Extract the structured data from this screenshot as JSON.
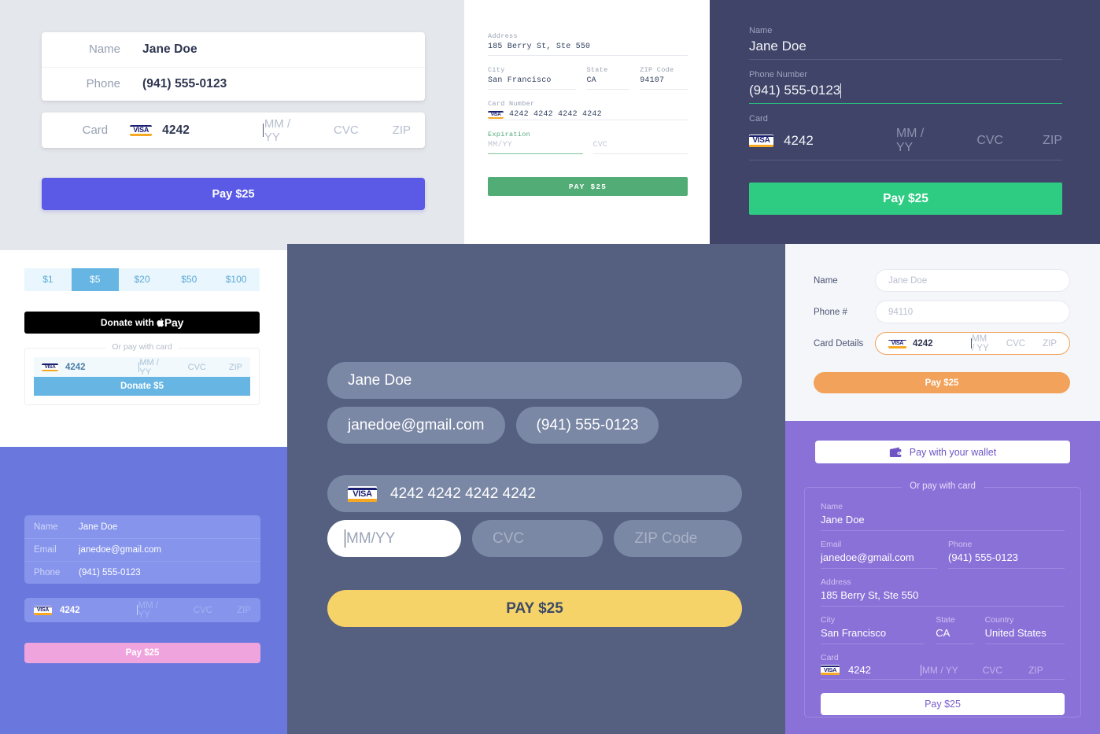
{
  "shared": {
    "visa_label": "VISA",
    "card_last4": "4242",
    "card_full": "4242 4242 4242 4242",
    "ph_mmyy_spaced": "MM / YY",
    "ph_mmyy": "MM/YY",
    "ph_cvc": "CVC",
    "ph_zip": "ZIP",
    "ph_zipcode": "ZIP Code",
    "name": "Jane Doe",
    "phone": "(941) 555-0123",
    "email": "janedoe@gmail.com",
    "address": "185 Berry St, Ste 550",
    "city": "San Francisco",
    "state": "CA",
    "zip": "94107",
    "country": "United States"
  },
  "panel1": {
    "labels": {
      "name": "Name",
      "phone": "Phone",
      "card": "Card"
    },
    "values": {
      "name": "Jane Doe",
      "phone": "(941) 555-0123",
      "card_last4": "4242"
    },
    "placeholders": {
      "mmyy": "MM / YY",
      "cvc": "CVC",
      "zip": "ZIP"
    },
    "pay_label": "Pay $25",
    "accent": "#5a5ae6"
  },
  "panel2": {
    "labels": {
      "address": "Address",
      "city": "City",
      "state": "State",
      "zip": "ZIP Code",
      "card_number": "Card Number",
      "expiration": "Expiration"
    },
    "values": {
      "address": "185 Berry St, Ste 550",
      "city": "San Francisco",
      "state": "CA",
      "zip": "94107",
      "card_full": "4242 4242 4242 4242"
    },
    "placeholders": {
      "mmyy": "MM/YY",
      "cvc": "CVC"
    },
    "pay_label": "PAY $25",
    "accent": "#51ac75"
  },
  "panel3": {
    "labels": {
      "name": "Name",
      "phone": "Phone Number",
      "card": "Card"
    },
    "values": {
      "name": "Jane Doe",
      "phone": "(941) 555-0123",
      "card_last4": "4242"
    },
    "placeholders": {
      "mmyy": "MM / YY",
      "cvc": "CVC",
      "zip": "ZIP"
    },
    "pay_label": "Pay $25",
    "accent": "#2ecc82",
    "background": "#3f4468"
  },
  "panel4": {
    "amounts": [
      "$1",
      "$5",
      "$20",
      "$50",
      "$100"
    ],
    "selected_amount": "$5",
    "apple_pay_label": "Donate with",
    "apple_pay_mark": "Pay",
    "or_pay_label": "Or pay with card",
    "card_last4": "4242",
    "placeholders": {
      "mmyy": "MM / YY",
      "cvc": "CVC",
      "zip": "ZIP"
    },
    "donate_label": "Donate $5",
    "accent": "#66b5e3"
  },
  "panel5": {
    "labels": {
      "name": "Name",
      "email": "Email",
      "phone": "Phone"
    },
    "values": {
      "name": "Jane Doe",
      "email": "janedoe@gmail.com",
      "phone": "(941) 555-0123",
      "card_last4": "4242"
    },
    "placeholders": {
      "mmyy": "MM / YY",
      "cvc": "CVC",
      "zip": "ZIP"
    },
    "pay_label": "Pay $25",
    "accent": "#efa4de",
    "background": "#6a78dd"
  },
  "panel6": {
    "values": {
      "name": "Jane Doe",
      "email": "janedoe@gmail.com",
      "phone": "(941) 555-0123",
      "card_full": "4242 4242 4242 4242"
    },
    "placeholders": {
      "mmyy": "MM/YY",
      "cvc": "CVC",
      "zip": "ZIP Code"
    },
    "pay_label": "PAY $25",
    "accent": "#f5d368",
    "background": "#556080"
  },
  "panel7": {
    "labels": {
      "name": "Name",
      "phone": "Phone #",
      "card": "Card Details"
    },
    "placeholders": {
      "name": "Jane Doe",
      "phone": "94110",
      "mmyy": "MM / YY",
      "cvc": "CVC",
      "zip": "ZIP"
    },
    "values": {
      "card_last4": "4242"
    },
    "pay_label": "Pay $25",
    "accent": "#f2a25a"
  },
  "panel8": {
    "wallet_label": "Pay with your wallet",
    "or_pay_label": "Or pay with card",
    "labels": {
      "name": "Name",
      "email": "Email",
      "phone": "Phone",
      "address": "Address",
      "city": "City",
      "state": "State",
      "country": "Country",
      "card": "Card"
    },
    "values": {
      "name": "Jane Doe",
      "email": "janedoe@gmail.com",
      "phone": "(941) 555-0123",
      "address": "185 Berry St, Ste 550",
      "city": "San Francisco",
      "state": "CA",
      "country": "United States",
      "card_last4": "4242"
    },
    "placeholders": {
      "mmyy": "MM / YY",
      "cvc": "CVC",
      "zip": "ZIP"
    },
    "pay_label": "Pay $25",
    "background": "#8a71d8"
  }
}
